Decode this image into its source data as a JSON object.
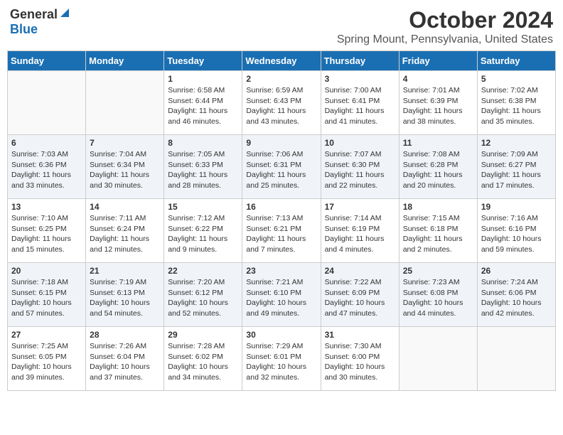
{
  "logo": {
    "general": "General",
    "blue": "Blue"
  },
  "title": "October 2024",
  "location": "Spring Mount, Pennsylvania, United States",
  "days_of_week": [
    "Sunday",
    "Monday",
    "Tuesday",
    "Wednesday",
    "Thursday",
    "Friday",
    "Saturday"
  ],
  "weeks": [
    [
      {
        "day": "",
        "info": ""
      },
      {
        "day": "",
        "info": ""
      },
      {
        "day": "1",
        "info": "Sunrise: 6:58 AM\nSunset: 6:44 PM\nDaylight: 11 hours and 46 minutes."
      },
      {
        "day": "2",
        "info": "Sunrise: 6:59 AM\nSunset: 6:43 PM\nDaylight: 11 hours and 43 minutes."
      },
      {
        "day": "3",
        "info": "Sunrise: 7:00 AM\nSunset: 6:41 PM\nDaylight: 11 hours and 41 minutes."
      },
      {
        "day": "4",
        "info": "Sunrise: 7:01 AM\nSunset: 6:39 PM\nDaylight: 11 hours and 38 minutes."
      },
      {
        "day": "5",
        "info": "Sunrise: 7:02 AM\nSunset: 6:38 PM\nDaylight: 11 hours and 35 minutes."
      }
    ],
    [
      {
        "day": "6",
        "info": "Sunrise: 7:03 AM\nSunset: 6:36 PM\nDaylight: 11 hours and 33 minutes."
      },
      {
        "day": "7",
        "info": "Sunrise: 7:04 AM\nSunset: 6:34 PM\nDaylight: 11 hours and 30 minutes."
      },
      {
        "day": "8",
        "info": "Sunrise: 7:05 AM\nSunset: 6:33 PM\nDaylight: 11 hours and 28 minutes."
      },
      {
        "day": "9",
        "info": "Sunrise: 7:06 AM\nSunset: 6:31 PM\nDaylight: 11 hours and 25 minutes."
      },
      {
        "day": "10",
        "info": "Sunrise: 7:07 AM\nSunset: 6:30 PM\nDaylight: 11 hours and 22 minutes."
      },
      {
        "day": "11",
        "info": "Sunrise: 7:08 AM\nSunset: 6:28 PM\nDaylight: 11 hours and 20 minutes."
      },
      {
        "day": "12",
        "info": "Sunrise: 7:09 AM\nSunset: 6:27 PM\nDaylight: 11 hours and 17 minutes."
      }
    ],
    [
      {
        "day": "13",
        "info": "Sunrise: 7:10 AM\nSunset: 6:25 PM\nDaylight: 11 hours and 15 minutes."
      },
      {
        "day": "14",
        "info": "Sunrise: 7:11 AM\nSunset: 6:24 PM\nDaylight: 11 hours and 12 minutes."
      },
      {
        "day": "15",
        "info": "Sunrise: 7:12 AM\nSunset: 6:22 PM\nDaylight: 11 hours and 9 minutes."
      },
      {
        "day": "16",
        "info": "Sunrise: 7:13 AM\nSunset: 6:21 PM\nDaylight: 11 hours and 7 minutes."
      },
      {
        "day": "17",
        "info": "Sunrise: 7:14 AM\nSunset: 6:19 PM\nDaylight: 11 hours and 4 minutes."
      },
      {
        "day": "18",
        "info": "Sunrise: 7:15 AM\nSunset: 6:18 PM\nDaylight: 11 hours and 2 minutes."
      },
      {
        "day": "19",
        "info": "Sunrise: 7:16 AM\nSunset: 6:16 PM\nDaylight: 10 hours and 59 minutes."
      }
    ],
    [
      {
        "day": "20",
        "info": "Sunrise: 7:18 AM\nSunset: 6:15 PM\nDaylight: 10 hours and 57 minutes."
      },
      {
        "day": "21",
        "info": "Sunrise: 7:19 AM\nSunset: 6:13 PM\nDaylight: 10 hours and 54 minutes."
      },
      {
        "day": "22",
        "info": "Sunrise: 7:20 AM\nSunset: 6:12 PM\nDaylight: 10 hours and 52 minutes."
      },
      {
        "day": "23",
        "info": "Sunrise: 7:21 AM\nSunset: 6:10 PM\nDaylight: 10 hours and 49 minutes."
      },
      {
        "day": "24",
        "info": "Sunrise: 7:22 AM\nSunset: 6:09 PM\nDaylight: 10 hours and 47 minutes."
      },
      {
        "day": "25",
        "info": "Sunrise: 7:23 AM\nSunset: 6:08 PM\nDaylight: 10 hours and 44 minutes."
      },
      {
        "day": "26",
        "info": "Sunrise: 7:24 AM\nSunset: 6:06 PM\nDaylight: 10 hours and 42 minutes."
      }
    ],
    [
      {
        "day": "27",
        "info": "Sunrise: 7:25 AM\nSunset: 6:05 PM\nDaylight: 10 hours and 39 minutes."
      },
      {
        "day": "28",
        "info": "Sunrise: 7:26 AM\nSunset: 6:04 PM\nDaylight: 10 hours and 37 minutes."
      },
      {
        "day": "29",
        "info": "Sunrise: 7:28 AM\nSunset: 6:02 PM\nDaylight: 10 hours and 34 minutes."
      },
      {
        "day": "30",
        "info": "Sunrise: 7:29 AM\nSunset: 6:01 PM\nDaylight: 10 hours and 32 minutes."
      },
      {
        "day": "31",
        "info": "Sunrise: 7:30 AM\nSunset: 6:00 PM\nDaylight: 10 hours and 30 minutes."
      },
      {
        "day": "",
        "info": ""
      },
      {
        "day": "",
        "info": ""
      }
    ]
  ]
}
